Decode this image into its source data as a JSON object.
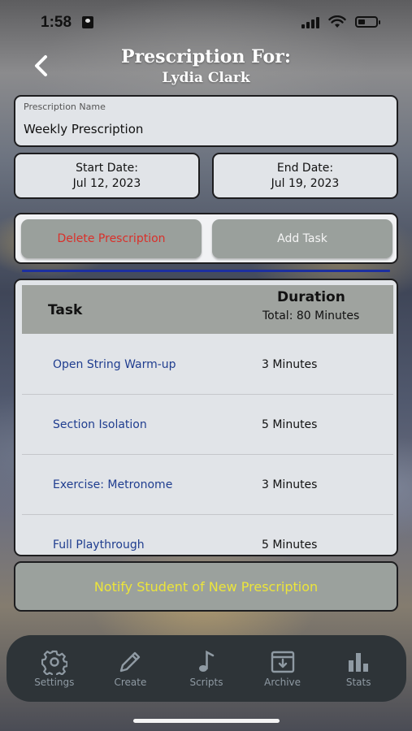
{
  "status_bar": {
    "time": "1:58"
  },
  "header": {
    "title": "Prescription For:",
    "student_name": "Lydia Clark"
  },
  "prescription": {
    "name_label": "Prescription Name",
    "name_value": "Weekly Prescription",
    "start_label": "Start Date:",
    "start_value": "Jul 12, 2023",
    "end_label": "End Date:",
    "end_value": "Jul 19, 2023"
  },
  "actions": {
    "delete_label": "Delete Prescription",
    "add_label": "Add Task"
  },
  "table": {
    "task_header": "Task",
    "duration_header": "Duration",
    "total_label": "Total: 80 Minutes",
    "rows": [
      {
        "task": "Open String Warm-up",
        "duration": "3 Minutes"
      },
      {
        "task": "Section Isolation",
        "duration": "5 Minutes"
      },
      {
        "task": "Exercise: Metronome",
        "duration": "3 Minutes"
      },
      {
        "task": "Full Playthrough",
        "duration": "5 Minutes"
      }
    ]
  },
  "notify_label": "Notify Student of New Prescription",
  "tabs": [
    {
      "label": "Settings",
      "icon": "gear-icon"
    },
    {
      "label": "Create",
      "icon": "pencil-icon"
    },
    {
      "label": "Scripts",
      "icon": "music-note-icon"
    },
    {
      "label": "Archive",
      "icon": "archive-box-icon"
    },
    {
      "label": "Stats",
      "icon": "bar-chart-icon"
    }
  ],
  "colors": {
    "delete_text": "#d9302a",
    "task_link": "#1f3d8f",
    "notify_text": "#ece53a",
    "divider_line": "#1c2fa0"
  }
}
